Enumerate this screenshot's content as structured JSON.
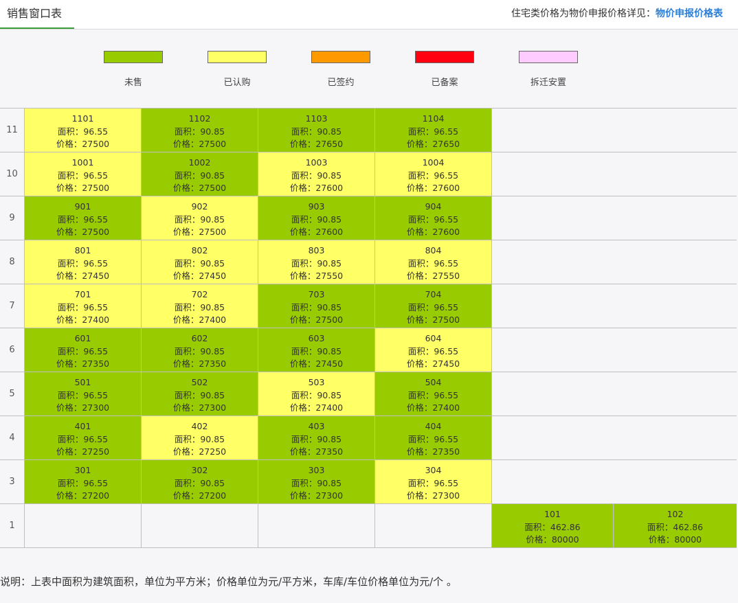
{
  "header": {
    "tab_label": "销售窗口表",
    "note_prefix": "住宅类价格为物价申报价格详见：",
    "note_link": "物价申报价格表"
  },
  "legend": [
    {
      "label": "未售",
      "color": "#99cc00"
    },
    {
      "label": "已认购",
      "color": "#ffff66"
    },
    {
      "label": "已签约",
      "color": "#ff9900"
    },
    {
      "label": "已备案",
      "color": "#ff0011"
    },
    {
      "label": "拆迁安置",
      "color": "#ffccff"
    }
  ],
  "status_colors": {
    "unsold": "#99cc00",
    "subscribed": "#ffff66",
    "signed": "#ff9900",
    "filed": "#ff0011",
    "relocation": "#ffccff",
    "empty": "#f6f5f7"
  },
  "grid": {
    "rows": [
      {
        "floor": "11",
        "units": [
          {
            "room": "1101",
            "area": "面积：96.55",
            "price": "价格：27500",
            "status": "subscribed"
          },
          {
            "room": "1102",
            "area": "面积：90.85",
            "price": "价格：27500",
            "status": "unsold"
          },
          {
            "room": "1103",
            "area": "面积：90.85",
            "price": "价格：27650",
            "status": "unsold"
          },
          {
            "room": "1104",
            "area": "面积：96.55",
            "price": "价格：27650",
            "status": "unsold"
          }
        ]
      },
      {
        "floor": "10",
        "units": [
          {
            "room": "1001",
            "area": "面积：96.55",
            "price": "价格：27500",
            "status": "subscribed"
          },
          {
            "room": "1002",
            "area": "面积：90.85",
            "price": "价格：27500",
            "status": "unsold"
          },
          {
            "room": "1003",
            "area": "面积：90.85",
            "price": "价格：27600",
            "status": "subscribed"
          },
          {
            "room": "1004",
            "area": "面积：96.55",
            "price": "价格：27600",
            "status": "subscribed"
          }
        ]
      },
      {
        "floor": "9",
        "units": [
          {
            "room": "901",
            "area": "面积：96.55",
            "price": "价格：27500",
            "status": "unsold"
          },
          {
            "room": "902",
            "area": "面积：90.85",
            "price": "价格：27500",
            "status": "subscribed"
          },
          {
            "room": "903",
            "area": "面积：90.85",
            "price": "价格：27600",
            "status": "unsold"
          },
          {
            "room": "904",
            "area": "面积：96.55",
            "price": "价格：27600",
            "status": "unsold"
          }
        ]
      },
      {
        "floor": "8",
        "units": [
          {
            "room": "801",
            "area": "面积：96.55",
            "price": "价格：27450",
            "status": "subscribed"
          },
          {
            "room": "802",
            "area": "面积：90.85",
            "price": "价格：27450",
            "status": "subscribed"
          },
          {
            "room": "803",
            "area": "面积：90.85",
            "price": "价格：27550",
            "status": "subscribed"
          },
          {
            "room": "804",
            "area": "面积：96.55",
            "price": "价格：27550",
            "status": "subscribed"
          }
        ]
      },
      {
        "floor": "7",
        "units": [
          {
            "room": "701",
            "area": "面积：96.55",
            "price": "价格：27400",
            "status": "subscribed"
          },
          {
            "room": "702",
            "area": "面积：90.85",
            "price": "价格：27400",
            "status": "subscribed"
          },
          {
            "room": "703",
            "area": "面积：90.85",
            "price": "价格：27500",
            "status": "unsold"
          },
          {
            "room": "704",
            "area": "面积：96.55",
            "price": "价格：27500",
            "status": "unsold"
          }
        ]
      },
      {
        "floor": "6",
        "units": [
          {
            "room": "601",
            "area": "面积：96.55",
            "price": "价格：27350",
            "status": "unsold"
          },
          {
            "room": "602",
            "area": "面积：90.85",
            "price": "价格：27350",
            "status": "unsold"
          },
          {
            "room": "603",
            "area": "面积：90.85",
            "price": "价格：27450",
            "status": "unsold"
          },
          {
            "room": "604",
            "area": "面积：96.55",
            "price": "价格：27450",
            "status": "subscribed"
          }
        ]
      },
      {
        "floor": "5",
        "units": [
          {
            "room": "501",
            "area": "面积：96.55",
            "price": "价格：27300",
            "status": "unsold"
          },
          {
            "room": "502",
            "area": "面积：90.85",
            "price": "价格：27300",
            "status": "unsold"
          },
          {
            "room": "503",
            "area": "面积：90.85",
            "price": "价格：27400",
            "status": "subscribed"
          },
          {
            "room": "504",
            "area": "面积：96.55",
            "price": "价格：27400",
            "status": "unsold"
          }
        ]
      },
      {
        "floor": "4",
        "units": [
          {
            "room": "401",
            "area": "面积：96.55",
            "price": "价格：27250",
            "status": "unsold"
          },
          {
            "room": "402",
            "area": "面积：90.85",
            "price": "价格：27250",
            "status": "subscribed"
          },
          {
            "room": "403",
            "area": "面积：90.85",
            "price": "价格：27350",
            "status": "unsold"
          },
          {
            "room": "404",
            "area": "面积：96.55",
            "price": "价格：27350",
            "status": "unsold"
          }
        ]
      },
      {
        "floor": "3",
        "units": [
          {
            "room": "301",
            "area": "面积：96.55",
            "price": "价格：27200",
            "status": "unsold"
          },
          {
            "room": "302",
            "area": "面积：90.85",
            "price": "价格：27200",
            "status": "unsold"
          },
          {
            "room": "303",
            "area": "面积：90.85",
            "price": "价格：27300",
            "status": "unsold"
          },
          {
            "room": "304",
            "area": "面积：96.55",
            "price": "价格：27300",
            "status": "subscribed"
          }
        ]
      },
      {
        "floor": "1",
        "units": [
          {
            "room": "",
            "area": "",
            "price": "",
            "status": "empty"
          },
          {
            "room": "",
            "area": "",
            "price": "",
            "status": "empty"
          },
          {
            "room": "",
            "area": "",
            "price": "",
            "status": "empty"
          },
          {
            "room": "",
            "area": "",
            "price": "",
            "status": "empty"
          },
          {
            "room": "101",
            "area": "面积：462.86",
            "price": "价格：80000",
            "status": "unsold"
          },
          {
            "room": "102",
            "area": "面积：462.86",
            "price": "价格：80000",
            "status": "unsold"
          }
        ]
      }
    ]
  },
  "footer": {
    "explanation": "说明：上表中面积为建筑面积，单位为平方米；价格单位为元/平方米，车库/车位价格单位为元/个 。"
  }
}
